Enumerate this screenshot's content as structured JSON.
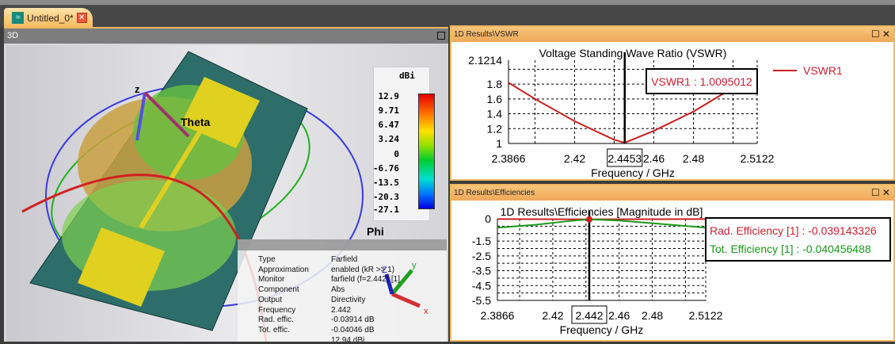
{
  "tab": {
    "label": "Untitled_0*",
    "icon": "wave-icon"
  },
  "view3d": {
    "title": "3D",
    "axis_labels": {
      "theta": "Theta",
      "phi": "Phi",
      "z": "z",
      "x": "x",
      "y": "y",
      "z2": "Z"
    },
    "colorbar": {
      "unit": "dBi",
      "ticks": [
        "12.9",
        "9.71",
        "6.47",
        "3.24",
        "0",
        "-6.76",
        "-13.5",
        "-20.3",
        "-27.1"
      ]
    },
    "info": [
      {
        "k": "Type",
        "v": "Farfield"
      },
      {
        "k": "Approximation",
        "v": "enabled (kR >> 1)"
      },
      {
        "k": "Monitor",
        "v": "farfield (f=2.442) [1]"
      },
      {
        "k": "Component",
        "v": "Abs"
      },
      {
        "k": "Output",
        "v": "Directivity"
      },
      {
        "k": "Frequency",
        "v": "2.442"
      },
      {
        "k": "Rad. effic.",
        "v": "-0.03914 dB"
      },
      {
        "k": "Tot. effic.",
        "v": "-0.04046 dB"
      },
      {
        "k": "",
        "v": "12.94 dBi"
      }
    ]
  },
  "vswr_panel": {
    "title": "1D Results\\VSWR",
    "buttons": "☐ ✕"
  },
  "eff_panel": {
    "title": "1D Results\\Efficiencies",
    "buttons": "☐ ✕"
  },
  "chart_data": [
    {
      "type": "line",
      "title": "Voltage Standing Wave Ratio (VSWR)",
      "xlabel": "Frequency / GHz",
      "ylabel": "",
      "xlim": [
        2.3866,
        2.5122
      ],
      "ylim": [
        1,
        2.1214
      ],
      "xticks": [
        "2.3866",
        "2.42",
        "2.46",
        "2.48",
        "2.5122"
      ],
      "xtick_vals": [
        2.3866,
        2.42,
        2.46,
        2.48,
        2.5122
      ],
      "xgrid": [
        2.3866,
        2.4,
        2.42,
        2.44,
        2.46,
        2.48,
        2.5,
        2.5122
      ],
      "yticks": [
        "2.1214",
        "1.8",
        "1.6",
        "1.4",
        "1.2",
        "1"
      ],
      "ytick_vals": [
        2.1214,
        1.8,
        1.6,
        1.4,
        1.2,
        1
      ],
      "ygrid": [
        2.0,
        1.8,
        1.6,
        1.4,
        1.2
      ],
      "marker_x": 2.4453,
      "marker_label": "2.4453",
      "annotation": "VSWR1 : 1.0095012",
      "legend": "top-right",
      "series": [
        {
          "name": "VSWR1",
          "color": "#cc2020",
          "x": [
            2.3866,
            2.4,
            2.42,
            2.44,
            2.4453,
            2.46,
            2.48,
            2.5,
            2.5122
          ],
          "y": [
            1.82,
            1.6,
            1.3,
            1.05,
            1.0095,
            1.17,
            1.43,
            1.75,
            1.98
          ]
        }
      ]
    },
    {
      "type": "line",
      "title": "1D Results\\Efficiencies [Magnitude in dB]",
      "xlabel": "Frequency / GHz",
      "ylabel": "",
      "xlim": [
        2.3866,
        2.5122
      ],
      "ylim": [
        -5.5,
        0
      ],
      "xticks": [
        "2.3866",
        "2.42",
        "2.46",
        "2.48",
        "2.5122"
      ],
      "xtick_vals": [
        2.3866,
        2.42,
        2.46,
        2.48,
        2.5122
      ],
      "xgrid": [
        2.3866,
        2.4,
        2.42,
        2.44,
        2.46,
        2.48,
        2.5,
        2.5122
      ],
      "yticks": [
        "0",
        "-1.5",
        "-2.5",
        "-3.5",
        "-4.5",
        "-5.5"
      ],
      "ytick_vals": [
        0,
        -1.5,
        -2.5,
        -3.5,
        -4.5,
        -5.5
      ],
      "ygrid": [
        -0.5,
        -1,
        -1.5,
        -2,
        -2.5,
        -3,
        -3.5,
        -4,
        -4.5,
        -5
      ],
      "marker_x": 2.442,
      "marker_label": "2.442",
      "annotations": [
        "Rad. Efficiency [1] : -0.039143326",
        "Tot. Efficiency [1] : -0.040456488"
      ],
      "series": [
        {
          "name": "Rad. Efficiency [1]",
          "color": "#cc2020",
          "x": [
            2.3866,
            2.442,
            2.5122
          ],
          "y": [
            -0.02,
            -0.039,
            -0.02
          ]
        },
        {
          "name": "Tot. Efficiency [1]",
          "color": "#1a9a1a",
          "x": [
            2.3866,
            2.41,
            2.43,
            2.442,
            2.46,
            2.48,
            2.5122
          ],
          "y": [
            -0.6,
            -0.4,
            -0.15,
            -0.04,
            -0.12,
            -0.3,
            -0.6
          ]
        }
      ]
    }
  ]
}
